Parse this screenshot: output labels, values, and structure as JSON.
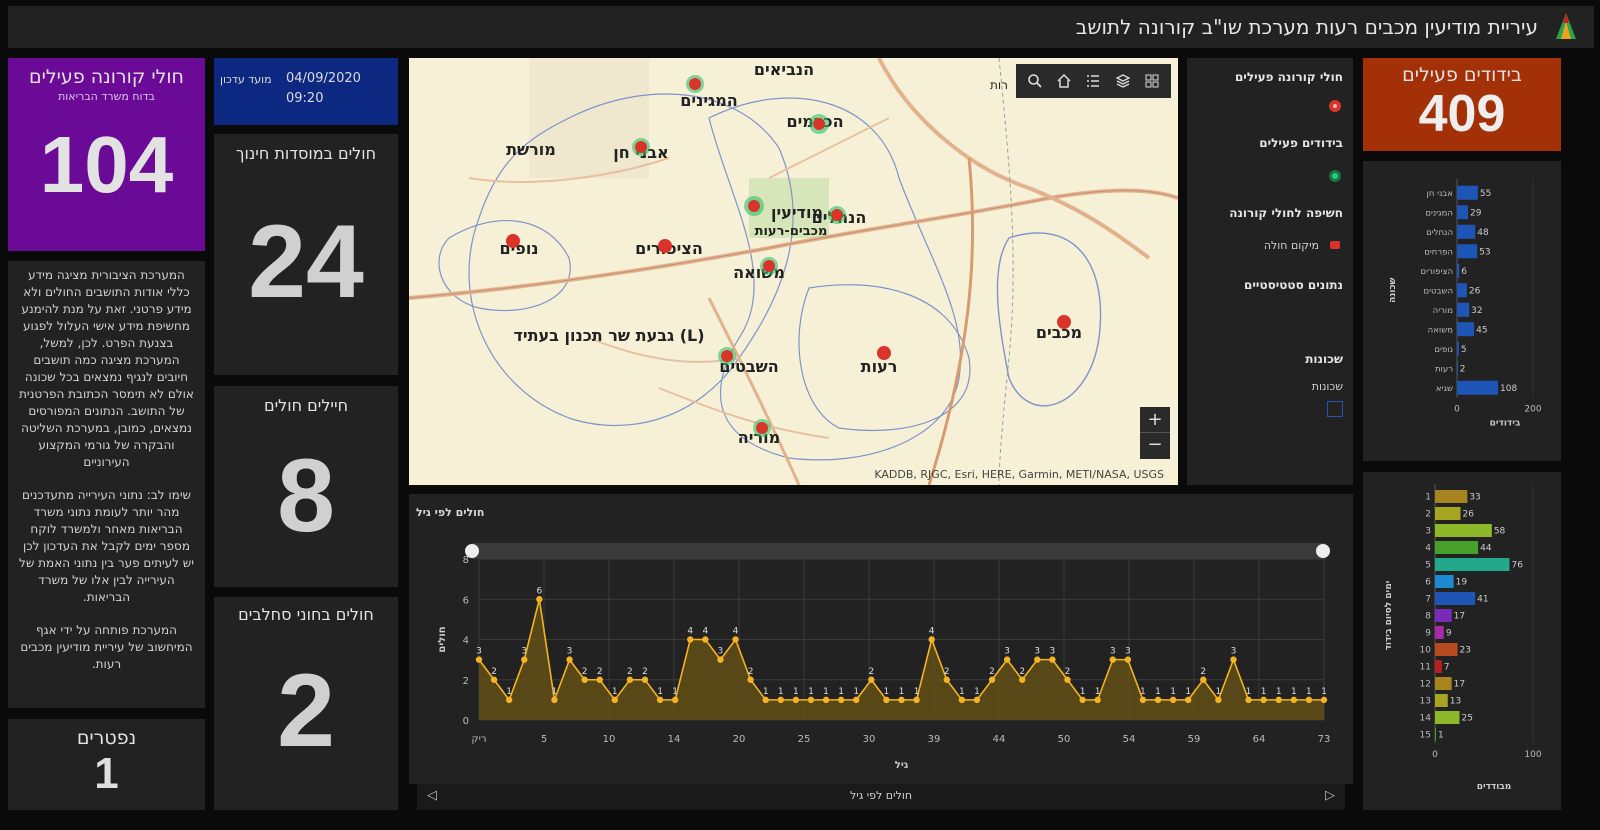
{
  "header": {
    "title": "עיריית מודיעין מכבים רעות מערכת שו\"ב קורונה לתושב"
  },
  "active_patients": {
    "title": "חולי קורונה פעילים",
    "subtitle": "בדוח משרד הבריאות",
    "value": "104"
  },
  "update": {
    "label": "מועד עדכון",
    "date": "04/09/2020",
    "time": "09:20"
  },
  "edu": {
    "title": "חולים במוסדות חינוך",
    "value": "24"
  },
  "soldiers": {
    "title": "חיילים חולים",
    "value": "8"
  },
  "milk": {
    "title": "חולים בחוני סחלבים",
    "value": "2"
  },
  "deceased": {
    "title": "נפטרים",
    "value": "1"
  },
  "isolation": {
    "title": "בידודים פעילים",
    "value": "409"
  },
  "info": {
    "p1": "המערכת הציבורית מציגה מידע כללי אודות התושבים החולים ולא מידע פרטני. זאת על מנת להימנע מחשיפת מידע אישי העלול לפגוע בצנעת הפרט. לכן, למשל, המערכת מציגה כמה תושבים חיובים לנגיף נמצאים בכל שכונה אולם לא תימסר הכתובת הפרטנית של התושב. הנתונים המפורסים נמצאים, כמובן, במערכת השליטה והבקרה של גורמי המקצוע העירוניים",
    "p2": "שימו לב: נתוני העירייה מתעדכנים מהר יותר לעומת נתוני משרד הבריאות מאחר ולמשרד לוקח מספר ימים לקבל את העדכון לכן יש לעיתים פער בין נתוני האמת של העירייה לבין אלו של משרד הבריאות.",
    "p3": "המערכת פותחה על ידי אגף המיחשוב של עיריית מודיעין מכבים רעות."
  },
  "map": {
    "attribution": "KADDB, RJGC, Esri, HERE, Garmin, METI/NASA, USGS",
    "labels": [
      "הנביאים",
      "המגינים",
      "הכרמים",
      "מורשת",
      "אבני חן",
      "מודיעין",
      "הנחלים",
      "מכבים-רעות",
      "נופים",
      "הציפורים",
      "משואה",
      "גבעת שר  תכנון בעתיד (L)",
      "השבטים",
      "רעות",
      "מכבים",
      "מוריה",
      "רות"
    ],
    "zoom_in": "+",
    "zoom_out": "−"
  },
  "legend": {
    "active": "חולי קורונה פעילים",
    "isolation": "בידודים פעילים",
    "exposure": "חשיפה לחולי קורונה",
    "exposure_item": "מיקום חולה",
    "stats": "נתונים סטטיסטיים",
    "neigh_h": "שכונות",
    "neigh_s": "שכונות"
  },
  "colors": {
    "purple": "#6a0a96",
    "blue": "#0d2880",
    "orange": "#a33006",
    "line": "#f5b324",
    "bar_blue": "#1e56b8"
  },
  "chart_data": [
    {
      "type": "area",
      "title": "חולים לפי גיל",
      "xlabel": "גיל",
      "ylabel": "חולים",
      "ylim": [
        0,
        8
      ],
      "yticks": [
        0,
        2,
        4,
        6,
        8
      ],
      "x_tick_labels": [
        "ריק",
        "5",
        "10",
        "14",
        "20",
        "25",
        "30",
        "39",
        "44",
        "50",
        "54",
        "59",
        "64",
        "73"
      ],
      "values": [
        3,
        2,
        1,
        3,
        6,
        1,
        3,
        2,
        2,
        1,
        2,
        2,
        1,
        1,
        4,
        4,
        3,
        4,
        2,
        1,
        1,
        1,
        1,
        1,
        1,
        1,
        2,
        1,
        1,
        1,
        4,
        2,
        1,
        1,
        2,
        3,
        2,
        3,
        3,
        2,
        1,
        1,
        3,
        3,
        1,
        1,
        1,
        1,
        2,
        1,
        3,
        1,
        1,
        1,
        1,
        1,
        1
      ],
      "footer": "חולים לפי גיל",
      "grid": true
    },
    {
      "type": "bar",
      "orientation": "horizontal",
      "ylabel": "שכונה",
      "xlabel": "בידודים",
      "xlim": [
        0,
        200
      ],
      "xticks": [
        "0",
        "200"
      ],
      "categories": [
        "אבני חן",
        "המגינים",
        "הנחלים",
        "הפרחים",
        "הציפורים",
        "השבטים",
        "מוריה",
        "משואה",
        "נופים",
        "רעות",
        "שגיא"
      ],
      "values": [
        55,
        29,
        48,
        53,
        6,
        26,
        32,
        45,
        5,
        2,
        108
      ]
    },
    {
      "type": "bar",
      "orientation": "horizontal",
      "ylabel": "ימים לסיום בידוד",
      "xlabel": "מבודדים",
      "xlim": [
        0,
        100
      ],
      "xticks": [
        "0",
        "100"
      ],
      "categories": [
        "1",
        "2",
        "3",
        "4",
        "5",
        "6",
        "7",
        "8",
        "9",
        "10",
        "11",
        "12",
        "13",
        "14",
        "15"
      ],
      "values": [
        33,
        26,
        58,
        44,
        76,
        19,
        41,
        17,
        9,
        23,
        7,
        17,
        13,
        25,
        1
      ],
      "colors": [
        "#a88420",
        "#a6a620",
        "#8cb82a",
        "#48a02c",
        "#22a88a",
        "#1c8ad0",
        "#1e56b8",
        "#7a2ab8",
        "#a42aa8",
        "#b84a20",
        "#b82020",
        "#a88420",
        "#a6a620",
        "#8cb82a",
        "#48a02c"
      ]
    }
  ]
}
